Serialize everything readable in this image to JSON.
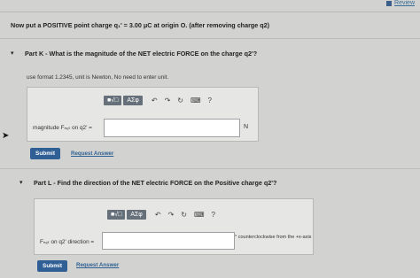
{
  "header": {
    "review_label": "Review"
  },
  "problem": {
    "text": "Now put a POSITIVE point charge q₁' = 3.00 μC at origin O. (after removing charge q2)"
  },
  "partK": {
    "title": "Part K - What is the magnitude of the NET electric FORCE on the charge q2'?",
    "instruction": "use format 1.2345, unit is Newton, No need to enter unit.",
    "toolbar": {
      "templates": "■√□",
      "greek": "AΣφ",
      "undo": "↶",
      "redo": "↷",
      "reset": "↻",
      "keyboard": "⌨",
      "help": "?"
    },
    "field_label": "magnitude Fₙₑₜ on q2' =",
    "field_value": "",
    "unit": "N",
    "submit_label": "Submit",
    "request_label": "Request Answer"
  },
  "partL": {
    "title": "Part L - Find the direction of the NET electric FORCE on the Positive charge q2'?",
    "toolbar": {
      "templates": "■√□",
      "greek": "AΣφ",
      "undo": "↶",
      "redo": "↷",
      "reset": "↻",
      "keyboard": "⌨",
      "help": "?"
    },
    "field_label": "Fₙₑₜ on q2' direction =",
    "field_value": "",
    "unit": "° counterclockwise from the +x-axis",
    "submit_label": "Submit",
    "request_label": "Request Answer"
  }
}
